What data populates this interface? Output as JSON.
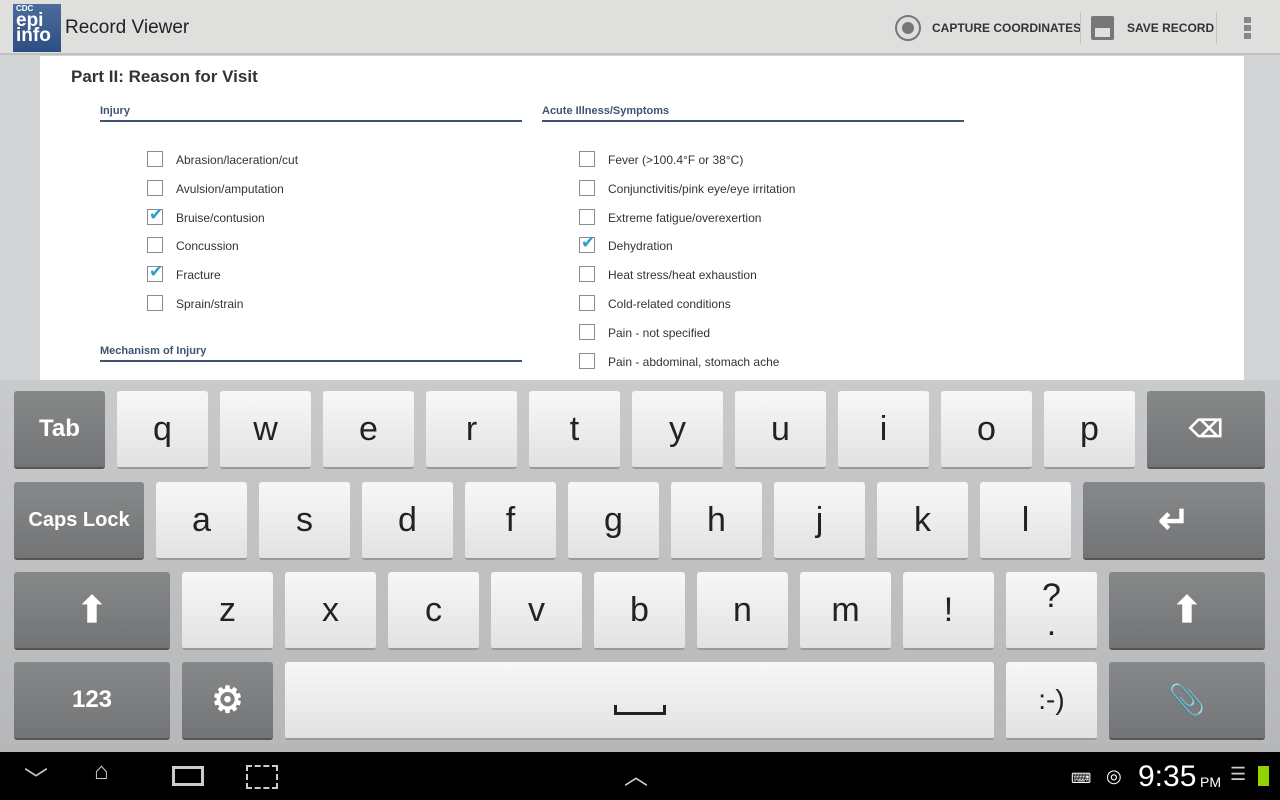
{
  "app": {
    "logo_top": "CDC",
    "logo_mid": "epi",
    "logo_bot": "info",
    "title": "Record Viewer",
    "capture": "CAPTURE COORDINATES",
    "save": "SAVE RECORD"
  },
  "form": {
    "part_title": "Part II: Reason for Visit",
    "injury": {
      "heading": "Injury",
      "items": [
        {
          "label": "Abrasion/laceration/cut",
          "checked": false
        },
        {
          "label": "Avulsion/amputation",
          "checked": false
        },
        {
          "label": "Bruise/contusion",
          "checked": true
        },
        {
          "label": "Concussion",
          "checked": false
        },
        {
          "label": "Fracture",
          "checked": true
        },
        {
          "label": "Sprain/strain",
          "checked": false
        }
      ]
    },
    "mechanism": {
      "heading": "Mechanism of Injury"
    },
    "acute": {
      "heading": "Acute Illness/Symptoms",
      "items": [
        {
          "label": "Fever (>100.4°F or 38°C)",
          "checked": false
        },
        {
          "label": "Conjunctivitis/pink eye/eye irritation",
          "checked": false
        },
        {
          "label": "Extreme fatigue/overexertion",
          "checked": false
        },
        {
          "label": "Dehydration",
          "checked": true
        },
        {
          "label": "Heat stress/heat exhaustion",
          "checked": false
        },
        {
          "label": "Cold-related conditions",
          "checked": false
        },
        {
          "label": "Pain - not specified",
          "checked": false
        },
        {
          "label": "Pain - abdominal, stomach ache",
          "checked": false
        }
      ]
    }
  },
  "keyboard": {
    "tab": "Tab",
    "caps": "Caps Lock",
    "num": "123",
    "smiley": ":-)",
    "row1": [
      "q",
      "w",
      "e",
      "r",
      "t",
      "y",
      "u",
      "i",
      "o",
      "p"
    ],
    "row2": [
      "a",
      "s",
      "d",
      "f",
      "g",
      "h",
      "j",
      "k",
      "l"
    ],
    "row3": [
      "z",
      "x",
      "c",
      "v",
      "b",
      "n",
      "m",
      "!",
      ","
    ],
    "q_key": "?",
    "q_sub": "."
  },
  "status": {
    "time": "9:35",
    "ampm": "PM"
  },
  "colors": {
    "check": "#2a9fc9",
    "section": "#3c5472",
    "battery": "#8fd400"
  }
}
